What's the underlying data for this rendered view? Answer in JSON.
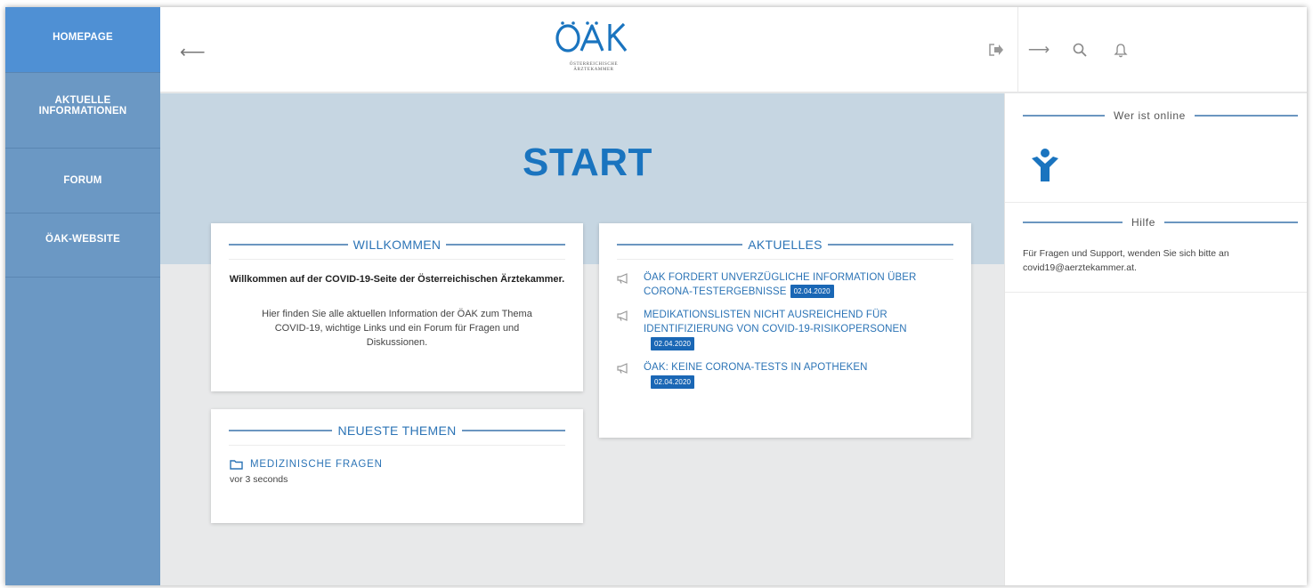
{
  "sidebar": {
    "items": [
      {
        "label": "HOMEPAGE"
      },
      {
        "label": "AKTUELLE INFORMATIONEN"
      },
      {
        "label": "FORUM"
      },
      {
        "label": "ÖAK-WEBSITE"
      }
    ]
  },
  "header": {
    "logo_text": "ÖAK",
    "logo_subtitle_1": "ÖSTERREICHISCHE",
    "logo_subtitle_2": "ÄRZTEKAMMER",
    "icons": [
      "back-arrow-icon",
      "exit-icon",
      "forward-arrow-icon",
      "search-icon",
      "bell-icon"
    ]
  },
  "main": {
    "title": "START",
    "welcome": {
      "heading": "WILLKOMMEN",
      "bold_text": "Willkommen auf der COVID-19-Seite der Österreichischen Ärztekammer.",
      "text": "Hier finden Sie alle aktuellen Information der ÖAK zum Thema COVID-19, wichtige Links und ein Forum für Fragen und Diskussionen."
    },
    "topics": {
      "heading": "NEUESTE THEMEN",
      "items": [
        {
          "title": "MEDIZINISCHE FRAGEN",
          "time": "vor 3 seconds"
        }
      ]
    },
    "news": {
      "heading": "AKTUELLES",
      "items": [
        {
          "title": "ÖAK FORDERT UNVERZÜGLICHE INFORMATION ÜBER CORONA-TESTERGEBNISSE",
          "date": "02.04.2020"
        },
        {
          "title": "MEDIKATIONSLISTEN NICHT AUSREICHEND FÜR IDENTIFIZIERUNG VON COVID-19-RISIKOPERSONEN",
          "date": "02.04.2020"
        },
        {
          "title": "ÖAK: KEINE CORONA-TESTS IN APOTHEKEN",
          "date": "02.04.2020"
        }
      ]
    }
  },
  "right_sidebar": {
    "online_heading": "Wer ist online",
    "help_heading": "Hilfe",
    "help_text": "Für Fragen und Support, wenden Sie sich bitte an covid19@aerztekammer.at."
  },
  "colors": {
    "sidebar": "#6b98c4",
    "sidebar_active": "#4f90d4",
    "accent": "#1a74bf",
    "badge": "#1a67b5",
    "banner": "#c6d6e2"
  }
}
